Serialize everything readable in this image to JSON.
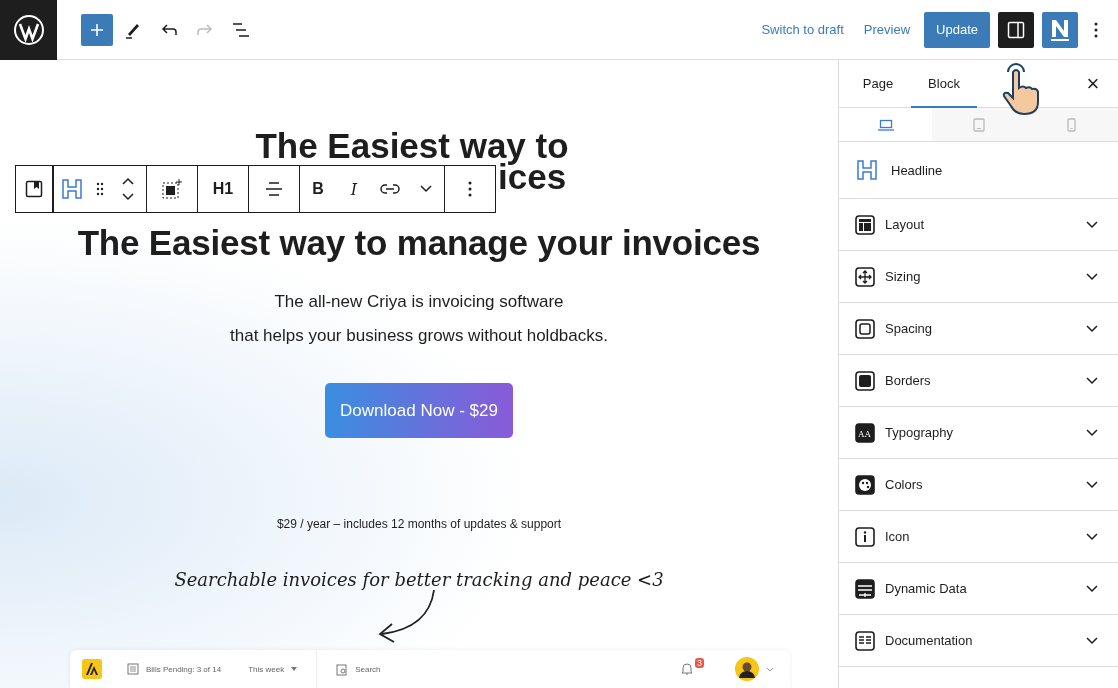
{
  "topbar": {
    "actions": [
      {
        "kind": "inserter",
        "selected": true
      },
      {
        "kind": "edit",
        "selected": false
      },
      {
        "kind": "undo",
        "disabled": false
      },
      {
        "kind": "redo",
        "disabled": true
      },
      {
        "kind": "outline",
        "selected": false
      }
    ],
    "links": [
      "Switch to draft",
      "Preview"
    ],
    "update": "Update",
    "settings_open": true
  },
  "block_toolbar": {
    "heading_level": "H1",
    "bold": "B",
    "italic": "I"
  },
  "canvas": {
    "heading_behind": [
      "The Easiest way to",
      "ices"
    ],
    "heading": "The Easiest way to manage your invoices",
    "subtitle": [
      "The all-new Criya is invoicing software",
      "that helps your business grows without holdbacks."
    ],
    "cta": "Download Now - $29",
    "note": "$29 / year – includes 12 months of updates & support",
    "handwriting": "Searchable invoices for better tracking and peace <3",
    "app_preview": {
      "bills": "Bills Pending: 3 of 14",
      "period": "This week",
      "search": "Search",
      "badge": "3"
    }
  },
  "sidebar": {
    "tabs": [
      {
        "label": "Page",
        "selected": false
      },
      {
        "label": "Block",
        "selected": true
      }
    ],
    "close": "×",
    "devices": [
      {
        "kind": "desktop",
        "selected": true
      },
      {
        "kind": "tablet",
        "selected": false
      },
      {
        "kind": "mobile",
        "selected": false
      }
    ],
    "block_name": "Headline",
    "panels": [
      {
        "kind": "layout",
        "label": "Layout",
        "expanded": false
      },
      {
        "kind": "sizing",
        "label": "Sizing",
        "expanded": false
      },
      {
        "kind": "spacing",
        "label": "Spacing",
        "expanded": false
      },
      {
        "kind": "borders",
        "label": "Borders",
        "expanded": false
      },
      {
        "kind": "typography",
        "label": "Typography",
        "expanded": false,
        "icon_text": "AA"
      },
      {
        "kind": "colors",
        "label": "Colors",
        "expanded": false
      },
      {
        "kind": "icon",
        "label": "Icon",
        "expanded": false
      },
      {
        "kind": "data",
        "label": "Dynamic Data",
        "expanded": false
      },
      {
        "kind": "docs",
        "label": "Documentation",
        "expanded": false
      }
    ]
  }
}
